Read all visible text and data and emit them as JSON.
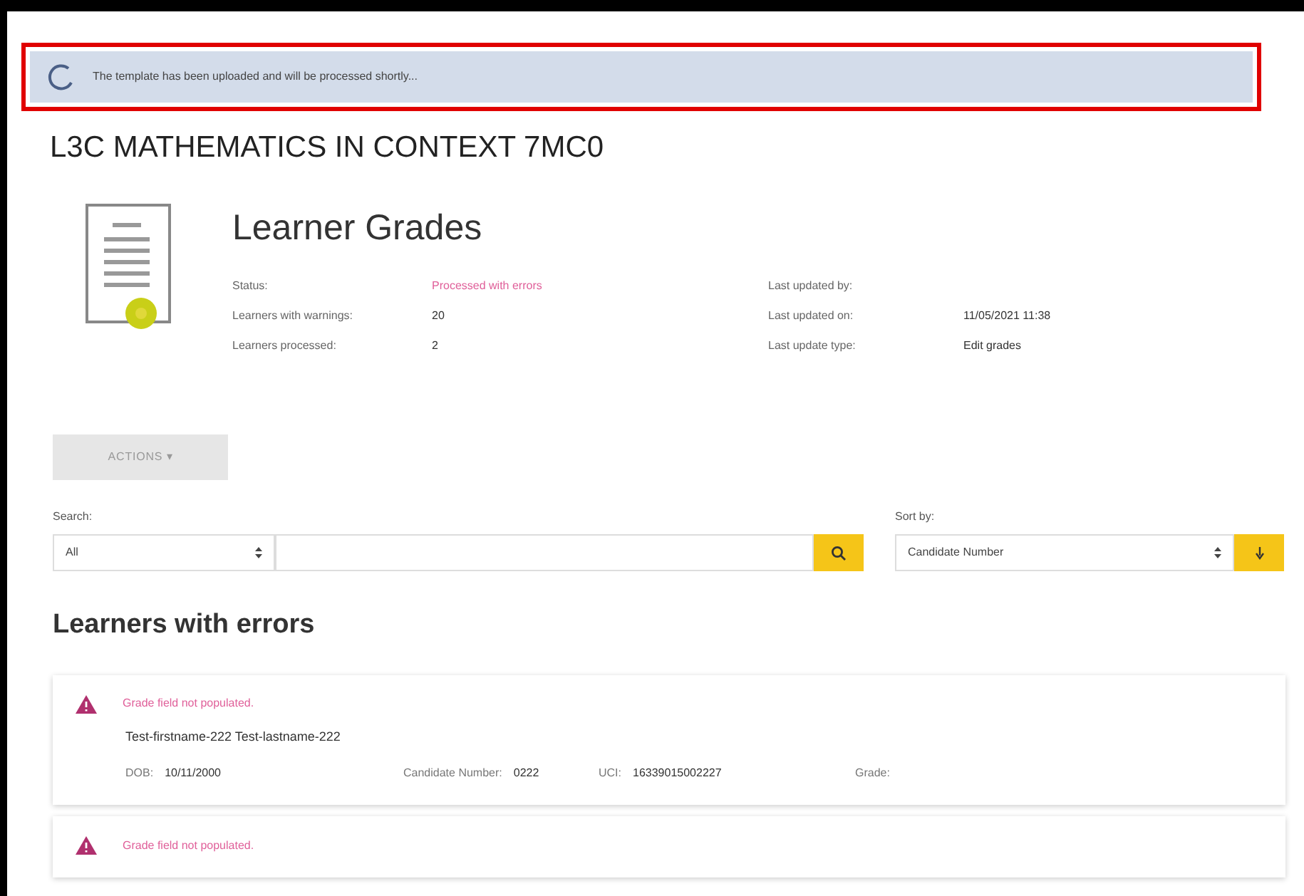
{
  "banner": {
    "message": "The template has been uploaded and will be processed shortly...",
    "highlighted": true
  },
  "course_title": "L3C MATHEMATICS IN CONTEXT 7MC0",
  "page_title": "Learner Grades",
  "details_left": [
    {
      "label": "Status:",
      "value": "Processed with errors",
      "kind": "error"
    },
    {
      "label": "Learners with warnings:",
      "value": "20",
      "kind": "plain"
    },
    {
      "label": "Learners processed:",
      "value": "2",
      "kind": "plain"
    }
  ],
  "details_right": [
    {
      "label": "Last updated by:"
    },
    {
      "label": "Last updated on:",
      "value": "11/05/2021 11:38"
    },
    {
      "label": "Last update type:",
      "value": "Edit grades"
    }
  ],
  "actions_button": {
    "label": "ACTIONS",
    "caret": "▾",
    "disabled": true
  },
  "search": {
    "label": "Search:",
    "scope": "All"
  },
  "sort": {
    "label": "Sort by:",
    "value": "Candidate Number"
  },
  "section_title": "Learners with errors",
  "learners": [
    {
      "message": "Grade field not populated.",
      "name": "Test-firstname-222 Test-lastname-222",
      "fields": [
        {
          "label": "DOB:",
          "value": "10/11/2000"
        },
        {
          "label": "Candidate Number:",
          "value": "0222"
        },
        {
          "label": "UCI:",
          "value": "16339015002227"
        },
        {
          "label": "Grade:"
        }
      ]
    },
    {
      "message": "Grade field not populated."
    }
  ]
}
